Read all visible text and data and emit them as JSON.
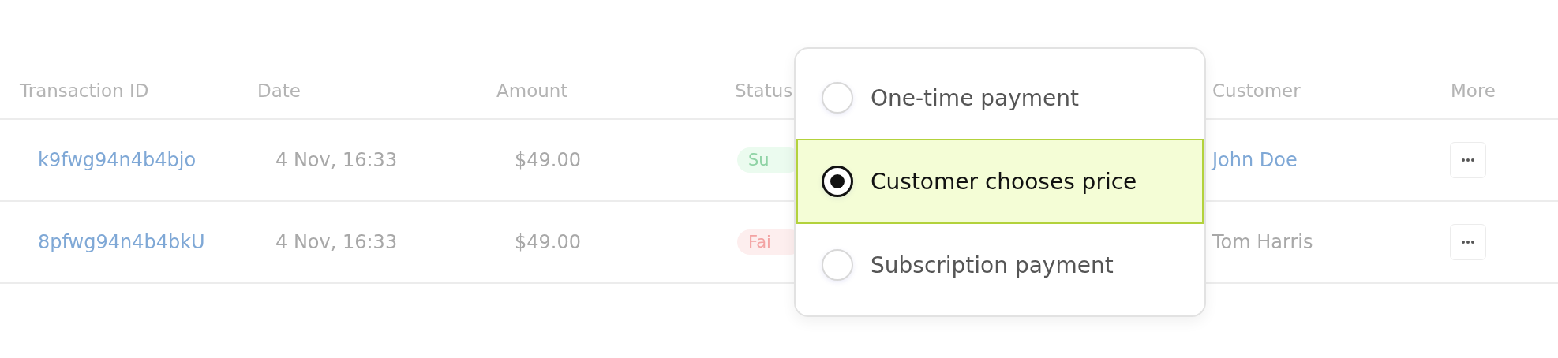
{
  "table": {
    "columns": [
      "Transaction ID",
      "Date",
      "Amount",
      "Status",
      "Customer",
      "More"
    ],
    "rows": [
      {
        "id": "k9fwg94n4b4bjo",
        "date": "4 Nov, 16:33",
        "amount": "$49.00",
        "status": {
          "kind": "success",
          "label": "Su"
        },
        "customer": "John Doe",
        "customer_link": true
      },
      {
        "id": "8pfwg94n4b4bkU",
        "date": "4 Nov, 16:33",
        "amount": "$49.00",
        "status": {
          "kind": "failed",
          "label": "Fai"
        },
        "customer": "Tom Harris",
        "customer_link": false
      }
    ]
  },
  "popover": {
    "options": [
      {
        "label": "One-time payment",
        "selected": false
      },
      {
        "label": "Customer chooses price",
        "selected": true
      },
      {
        "label": "Subscription payment",
        "selected": false
      }
    ]
  }
}
